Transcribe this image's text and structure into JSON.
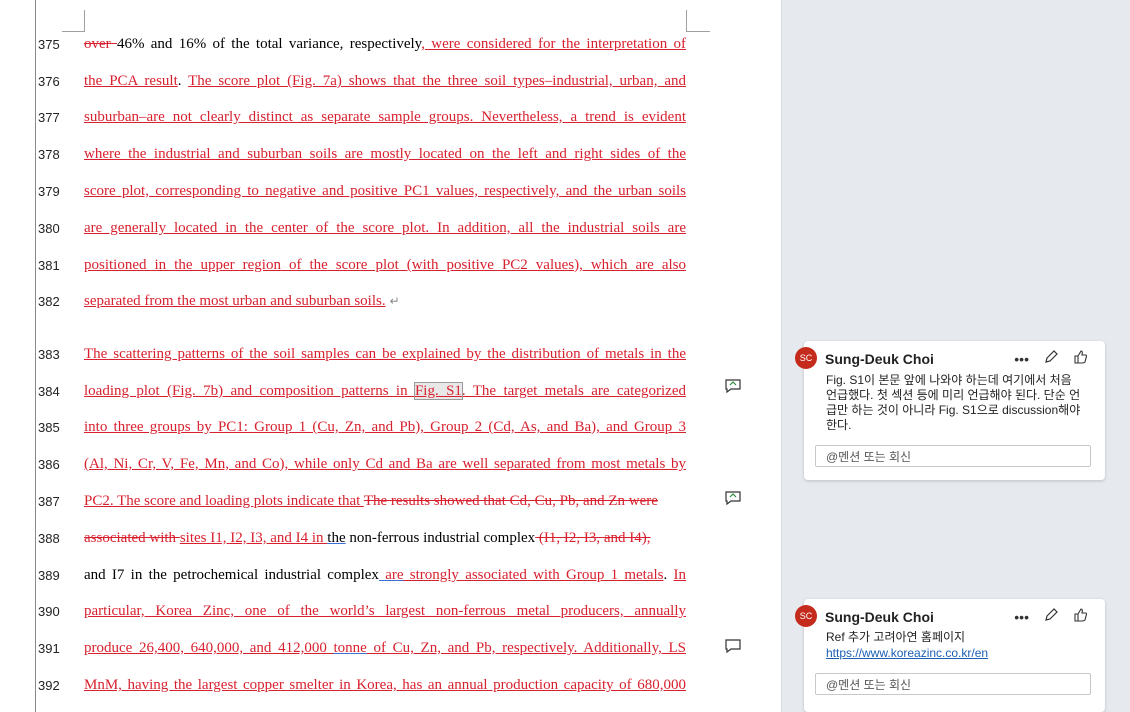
{
  "lines": [
    {
      "num": "375",
      "segments": [
        {
          "t": "over ",
          "s": "del"
        },
        {
          "t": "46% and 16% of the total variance, respectively",
          "s": "plain"
        },
        {
          "t": ", were considered for the interpretation of",
          "s": "ins"
        }
      ]
    },
    {
      "num": "376",
      "segments": [
        {
          "t": "the PCA result",
          "s": "ins"
        },
        {
          "t": ". ",
          "s": "plain"
        },
        {
          "t": "The score plot (Fig. 7a) shows that the three soil types–industrial, urban, and",
          "s": "ins"
        }
      ]
    },
    {
      "num": "377",
      "segments": [
        {
          "t": "suburban–are not clearly distinct as separate sample groups. Nevertheless, a trend is evident",
          "s": "ins"
        }
      ]
    },
    {
      "num": "378",
      "segments": [
        {
          "t": "where the industrial and suburban soils are mostly located on the left and right sides of the",
          "s": "ins"
        }
      ]
    },
    {
      "num": "379",
      "segments": [
        {
          "t": "score plot, corresponding to negative and positive PC1 values, respectively, and the urban soils",
          "s": "ins"
        }
      ]
    },
    {
      "num": "380",
      "segments": [
        {
          "t": "are generally located in the center of the score plot. In addition, all the industrial soils are",
          "s": "ins"
        }
      ]
    },
    {
      "num": "381",
      "segments": [
        {
          "t": "positioned in the upper region of the score plot (with positive PC2 values), which are also",
          "s": "ins"
        }
      ]
    },
    {
      "num": "382",
      "segments": [
        {
          "t": "separated from the most urban and suburban soils.",
          "s": "ins"
        }
      ]
    },
    {
      "num": "383",
      "segments": [
        {
          "t": "The scattering patterns of the soil samples can be explained by the distribution of metals in the",
          "s": "ins"
        }
      ]
    },
    {
      "num": "384",
      "segments": [
        {
          "t": "loading plot (Fig. 7b) and composition patterns in ",
          "s": "ins"
        },
        {
          "t": "Fig. S1",
          "s": "ins-hl"
        },
        {
          "t": ". The target metals are categorized",
          "s": "ins"
        }
      ]
    },
    {
      "num": "385",
      "segments": [
        {
          "t": "into three groups by PC1: Group 1 (Cu, Zn, and Pb), Group 2 (Cd, As, and Ba), and Group 3",
          "s": "ins"
        }
      ]
    },
    {
      "num": "386",
      "segments": [
        {
          "t": "(Al, Ni, Cr, V, Fe, Mn, and Co), while only Cd and Ba are well separated from most metals by",
          "s": "ins"
        }
      ]
    },
    {
      "num": "387",
      "segments": [
        {
          "t": "PC2. The score and loading plots indicate that ",
          "s": "ins"
        },
        {
          "t": "The results showed that Cd, Cu, Pb, and Zn were",
          "s": "del"
        }
      ]
    },
    {
      "num": "388",
      "segments": [
        {
          "t": "associated with ",
          "s": "del"
        },
        {
          "t": "sites I1, I2, I3, and I4 in ",
          "s": "ins"
        },
        {
          "t": "the",
          "s": "blue"
        },
        {
          "t": " non-ferrous industrial complex",
          "s": "plain"
        },
        {
          "t": " (I1, I2, I3, and I4),",
          "s": "del"
        }
      ]
    },
    {
      "num": "389",
      "segments": [
        {
          "t": "and I7 in the petrochemical industrial complex",
          "s": "plain"
        },
        {
          "t": " are",
          "s": "ins-blue"
        },
        {
          "t": " strongly associated with Group 1 metals",
          "s": "ins"
        },
        {
          "t": ". ",
          "s": "plain"
        },
        {
          "t": "In",
          "s": "ins"
        }
      ]
    },
    {
      "num": "390",
      "segments": [
        {
          "t": "particular, Korea Zinc, one of the world’s largest non-ferrous metal producers, annually",
          "s": "ins"
        }
      ]
    },
    {
      "num": "391",
      "segments": [
        {
          "t": "produce 26,400, 640,000, and 412,000 ",
          "s": "ins"
        },
        {
          "t": "tonne",
          "s": "ins-blue"
        },
        {
          "t": " of Cu, Zn, and Pb, respectively",
          "s": "ins"
        },
        {
          "t": ". Additionally, LS",
          "s": "ins"
        }
      ]
    },
    {
      "num": "392",
      "segments": [
        {
          "t": "MnM, having the largest copper smelter in Korea, has an annual production capacity of 680,000",
          "s": "ins"
        }
      ]
    }
  ],
  "comments": [
    {
      "initials": "SC",
      "author": "Sung-Deuk Choi",
      "body": "Fig. S1이 본문 앞에 나와야 하는데 여기에서 처음 언급했다. 첫 섹션 등에 미리 언급해야 된다. 단순 언급만 하는 것이 아니라 Fig. S1으로 discussion해야 한다.",
      "reply_placeholder": "@멘션 또는 회신"
    },
    {
      "initials": "SC",
      "author": "Sung-Deuk Choi",
      "body": "Ref 추가 고려아연 홈페이지",
      "link": "https://www.koreazinc.co.kr/en",
      "reply_placeholder": "@멘션 또는 회신"
    }
  ],
  "icons": {
    "more": "more-options-icon",
    "edit": "edit-pencil-icon",
    "like": "thumbs-up-icon",
    "comment_marker": "comment-marker-icon"
  },
  "colors": {
    "insert": "#d8212f",
    "accent_avatar": "#c42b1c",
    "pane_bg": "#e6e9ee",
    "link": "#1a5fb4"
  }
}
